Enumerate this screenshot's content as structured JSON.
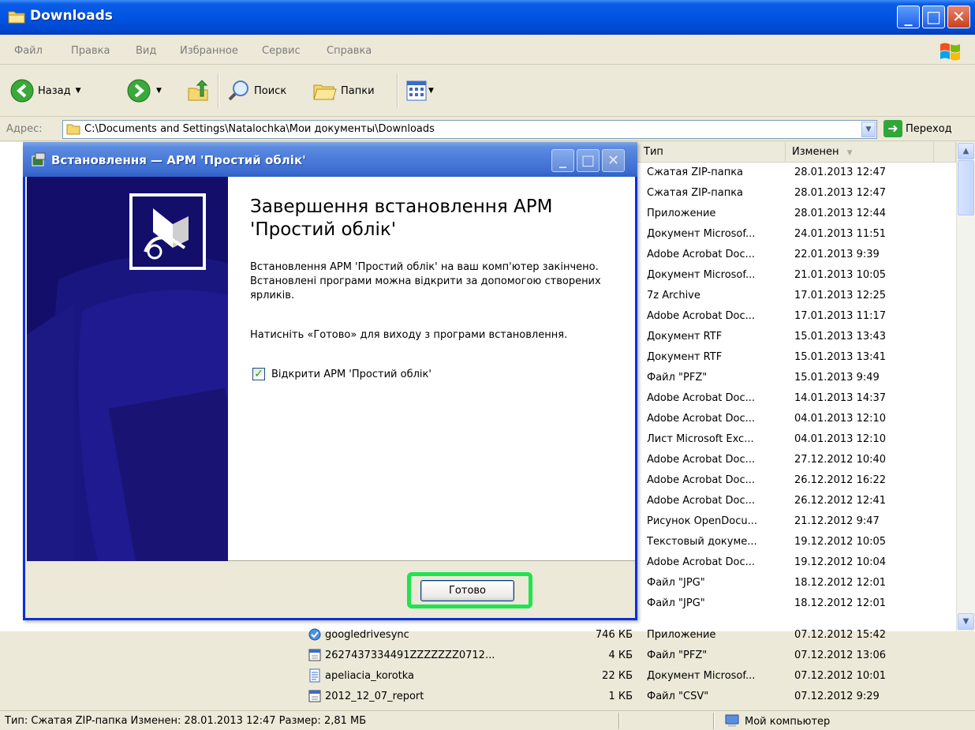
{
  "window": {
    "title": "Downloads"
  },
  "menu": [
    "Файл",
    "Правка",
    "Вид",
    "Избранное",
    "Сервис",
    "Справка"
  ],
  "toolbar": {
    "back": "Назад",
    "search": "Поиск",
    "folders": "Папки"
  },
  "address": {
    "label": "Адрес:",
    "path": "C:\\Documents and Settings\\Natalochka\\Мои документы\\Downloads",
    "go": "Переход"
  },
  "columns": {
    "type": "Тип",
    "modified": "Изменен"
  },
  "files_right": [
    {
      "type": "Сжатая ZIP-папка",
      "date": "28.01.2013 12:47"
    },
    {
      "type": "Сжатая ZIP-папка",
      "date": "28.01.2013 12:47"
    },
    {
      "type": "Приложение",
      "date": "28.01.2013 12:44"
    },
    {
      "type": "Документ Microsof...",
      "date": "24.01.2013 11:51"
    },
    {
      "type": "Adobe Acrobat Doc...",
      "date": "22.01.2013 9:39"
    },
    {
      "type": "Документ Microsof...",
      "date": "21.01.2013 10:05"
    },
    {
      "type": "7z Archive",
      "date": "17.01.2013 12:25"
    },
    {
      "type": "Adobe Acrobat Doc...",
      "date": "17.01.2013 11:17"
    },
    {
      "type": "Документ RTF",
      "date": "15.01.2013 13:43"
    },
    {
      "type": "Документ RTF",
      "date": "15.01.2013 13:41"
    },
    {
      "type": "Файл \"PFZ\"",
      "date": "15.01.2013 9:49"
    },
    {
      "type": "Adobe Acrobat Doc...",
      "date": "14.01.2013 14:37"
    },
    {
      "type": "Adobe Acrobat Doc...",
      "date": "04.01.2013 12:10"
    },
    {
      "type": "Лист Microsoft Exc...",
      "date": "04.01.2013 12:10"
    },
    {
      "type": "Adobe Acrobat Doc...",
      "date": "27.12.2012 10:40"
    },
    {
      "type": "Adobe Acrobat Doc...",
      "date": "26.12.2012 16:22"
    },
    {
      "type": "Adobe Acrobat Doc...",
      "date": "26.12.2012 12:41"
    },
    {
      "type": "Рисунок OpenDocu...",
      "date": "21.12.2012 9:47"
    },
    {
      "type": "Текстовый докуме...",
      "date": "19.12.2012 10:05"
    },
    {
      "type": "Adobe Acrobat Doc...",
      "date": "19.12.2012 10:04"
    },
    {
      "type": "Файл \"JPG\"",
      "date": "18.12.2012 12:01"
    },
    {
      "type": "Файл \"JPG\"",
      "date": "18.12.2012 12:01"
    }
  ],
  "files_full": [
    {
      "name": "googledrivesync",
      "size": "746 КБ",
      "type": "Приложение",
      "date": "07.12.2012 15:42",
      "icon": "app-icon"
    },
    {
      "name": "2627437334491ZZZZZZZ0712...",
      "size": "4 КБ",
      "type": "Файл \"PFZ\"",
      "date": "07.12.2012 13:06",
      "icon": "file-icon"
    },
    {
      "name": "apeliacia_korotka",
      "size": "22 КБ",
      "type": "Документ Microsof...",
      "date": "07.12.2012 10:01",
      "icon": "doc-icon"
    },
    {
      "name": "2012_12_07_report",
      "size": "1 КБ",
      "type": "Файл \"CSV\"",
      "date": "07.12.2012 9:29",
      "icon": "file-icon"
    }
  ],
  "status": {
    "text": "Тип: Сжатая ZIP-папка Изменен: 28.01.2013 12:47 Размер: 2,81 МБ",
    "computer": "Мой компьютер"
  },
  "dialog": {
    "title": "Встановлення — АРМ 'Простий облік'",
    "heading": "Завершення встановлення АРМ 'Простий облік'",
    "p1": "Встановлення АРМ 'Простий облік' на ваш комп'ютер закінчено. Встановлені програми можна відкрити за допомогою створених ярликів.",
    "p2": "Натисніть «Готово» для виходу з програми встановлення.",
    "checkbox_label": "Відкрити АРМ 'Простий облік'",
    "checkbox_checked": true,
    "finish_button": "Готово"
  },
  "colors": {
    "highlight_ring": "#1fe34f",
    "dialog_side": "#120e6a",
    "titlebar": "#0054e3"
  }
}
